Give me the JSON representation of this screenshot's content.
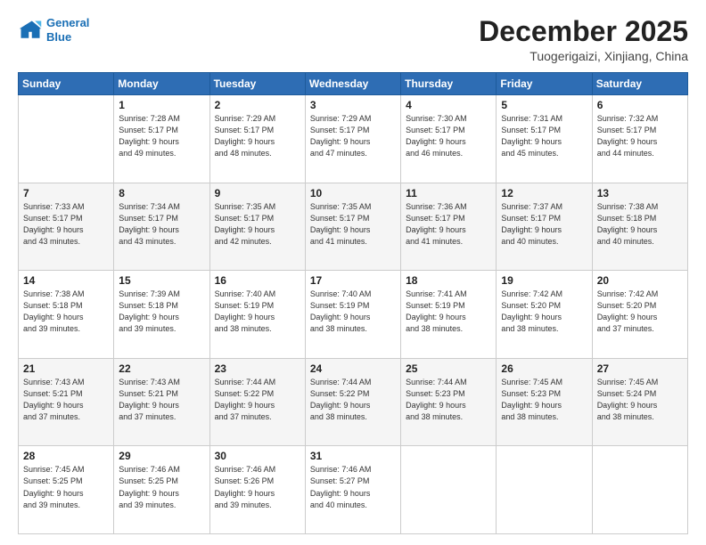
{
  "logo": {
    "line1": "General",
    "line2": "Blue"
  },
  "title": "December 2025",
  "subtitle": "Tuogerigaizi, Xinjiang, China",
  "days_of_week": [
    "Sunday",
    "Monday",
    "Tuesday",
    "Wednesday",
    "Thursday",
    "Friday",
    "Saturday"
  ],
  "weeks": [
    [
      {
        "day": "",
        "info": ""
      },
      {
        "day": "1",
        "info": "Sunrise: 7:28 AM\nSunset: 5:17 PM\nDaylight: 9 hours\nand 49 minutes."
      },
      {
        "day": "2",
        "info": "Sunrise: 7:29 AM\nSunset: 5:17 PM\nDaylight: 9 hours\nand 48 minutes."
      },
      {
        "day": "3",
        "info": "Sunrise: 7:29 AM\nSunset: 5:17 PM\nDaylight: 9 hours\nand 47 minutes."
      },
      {
        "day": "4",
        "info": "Sunrise: 7:30 AM\nSunset: 5:17 PM\nDaylight: 9 hours\nand 46 minutes."
      },
      {
        "day": "5",
        "info": "Sunrise: 7:31 AM\nSunset: 5:17 PM\nDaylight: 9 hours\nand 45 minutes."
      },
      {
        "day": "6",
        "info": "Sunrise: 7:32 AM\nSunset: 5:17 PM\nDaylight: 9 hours\nand 44 minutes."
      }
    ],
    [
      {
        "day": "7",
        "info": "Sunrise: 7:33 AM\nSunset: 5:17 PM\nDaylight: 9 hours\nand 43 minutes."
      },
      {
        "day": "8",
        "info": "Sunrise: 7:34 AM\nSunset: 5:17 PM\nDaylight: 9 hours\nand 43 minutes."
      },
      {
        "day": "9",
        "info": "Sunrise: 7:35 AM\nSunset: 5:17 PM\nDaylight: 9 hours\nand 42 minutes."
      },
      {
        "day": "10",
        "info": "Sunrise: 7:35 AM\nSunset: 5:17 PM\nDaylight: 9 hours\nand 41 minutes."
      },
      {
        "day": "11",
        "info": "Sunrise: 7:36 AM\nSunset: 5:17 PM\nDaylight: 9 hours\nand 41 minutes."
      },
      {
        "day": "12",
        "info": "Sunrise: 7:37 AM\nSunset: 5:17 PM\nDaylight: 9 hours\nand 40 minutes."
      },
      {
        "day": "13",
        "info": "Sunrise: 7:38 AM\nSunset: 5:18 PM\nDaylight: 9 hours\nand 40 minutes."
      }
    ],
    [
      {
        "day": "14",
        "info": "Sunrise: 7:38 AM\nSunset: 5:18 PM\nDaylight: 9 hours\nand 39 minutes."
      },
      {
        "day": "15",
        "info": "Sunrise: 7:39 AM\nSunset: 5:18 PM\nDaylight: 9 hours\nand 39 minutes."
      },
      {
        "day": "16",
        "info": "Sunrise: 7:40 AM\nSunset: 5:19 PM\nDaylight: 9 hours\nand 38 minutes."
      },
      {
        "day": "17",
        "info": "Sunrise: 7:40 AM\nSunset: 5:19 PM\nDaylight: 9 hours\nand 38 minutes."
      },
      {
        "day": "18",
        "info": "Sunrise: 7:41 AM\nSunset: 5:19 PM\nDaylight: 9 hours\nand 38 minutes."
      },
      {
        "day": "19",
        "info": "Sunrise: 7:42 AM\nSunset: 5:20 PM\nDaylight: 9 hours\nand 38 minutes."
      },
      {
        "day": "20",
        "info": "Sunrise: 7:42 AM\nSunset: 5:20 PM\nDaylight: 9 hours\nand 37 minutes."
      }
    ],
    [
      {
        "day": "21",
        "info": "Sunrise: 7:43 AM\nSunset: 5:21 PM\nDaylight: 9 hours\nand 37 minutes."
      },
      {
        "day": "22",
        "info": "Sunrise: 7:43 AM\nSunset: 5:21 PM\nDaylight: 9 hours\nand 37 minutes."
      },
      {
        "day": "23",
        "info": "Sunrise: 7:44 AM\nSunset: 5:22 PM\nDaylight: 9 hours\nand 37 minutes."
      },
      {
        "day": "24",
        "info": "Sunrise: 7:44 AM\nSunset: 5:22 PM\nDaylight: 9 hours\nand 38 minutes."
      },
      {
        "day": "25",
        "info": "Sunrise: 7:44 AM\nSunset: 5:23 PM\nDaylight: 9 hours\nand 38 minutes."
      },
      {
        "day": "26",
        "info": "Sunrise: 7:45 AM\nSunset: 5:23 PM\nDaylight: 9 hours\nand 38 minutes."
      },
      {
        "day": "27",
        "info": "Sunrise: 7:45 AM\nSunset: 5:24 PM\nDaylight: 9 hours\nand 38 minutes."
      }
    ],
    [
      {
        "day": "28",
        "info": "Sunrise: 7:45 AM\nSunset: 5:25 PM\nDaylight: 9 hours\nand 39 minutes."
      },
      {
        "day": "29",
        "info": "Sunrise: 7:46 AM\nSunset: 5:25 PM\nDaylight: 9 hours\nand 39 minutes."
      },
      {
        "day": "30",
        "info": "Sunrise: 7:46 AM\nSunset: 5:26 PM\nDaylight: 9 hours\nand 39 minutes."
      },
      {
        "day": "31",
        "info": "Sunrise: 7:46 AM\nSunset: 5:27 PM\nDaylight: 9 hours\nand 40 minutes."
      },
      {
        "day": "",
        "info": ""
      },
      {
        "day": "",
        "info": ""
      },
      {
        "day": "",
        "info": ""
      }
    ]
  ]
}
